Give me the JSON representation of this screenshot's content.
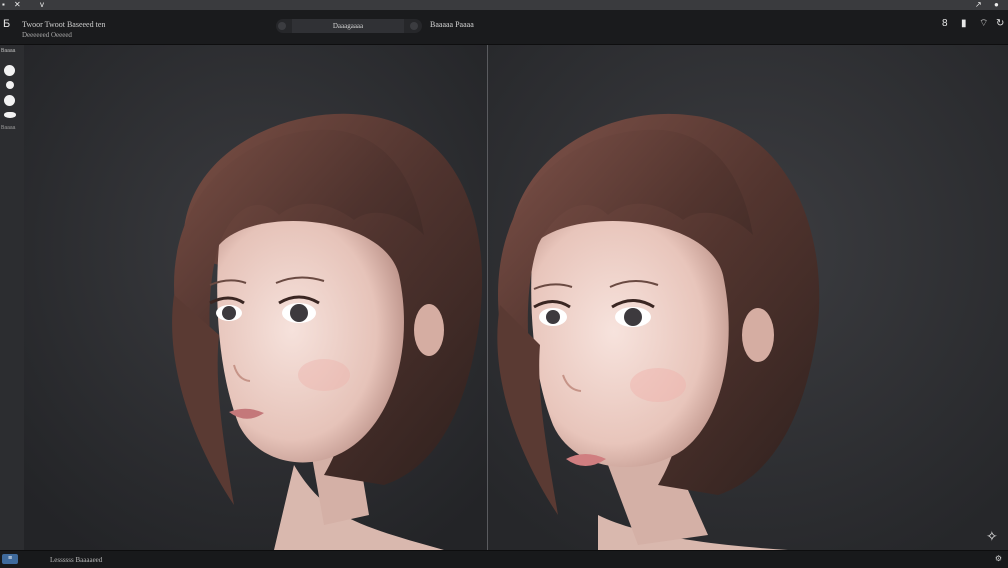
{
  "window": {
    "title": "Twoor  Twoot  Baseeed  ten",
    "subtitle": "Deeeeeed   Oeeeed"
  },
  "topstrip": {
    "icons": [
      "window-icon",
      "close-icon",
      "menu-icon"
    ]
  },
  "header": {
    "center_tab": "Daaagaaaa",
    "compare_label": "Baaaaa  Paaaa",
    "right_icons": [
      "save-icon",
      "phone-icon",
      "wifi-icon",
      "refresh-icon"
    ]
  },
  "sidebar": {
    "section_label": "Baaaa",
    "tools": [
      "circle-brush-icon",
      "small-brush-icon",
      "large-brush-icon",
      "mask-icon"
    ],
    "lower_label": "Baaaa"
  },
  "viewer": {
    "left_panel": "before-image",
    "right_panel": "after-image",
    "background": "#2c2d30",
    "hair_color": "#5a3a33"
  },
  "status_bar": {
    "badge": "≡",
    "status_text": "Lessssss  Baaaaeed",
    "right_icon": "settings-icon"
  },
  "colors": {
    "accent": "#3f6a9c",
    "titlebar": "#1a1b1d",
    "canvas": "#2c2d30"
  }
}
